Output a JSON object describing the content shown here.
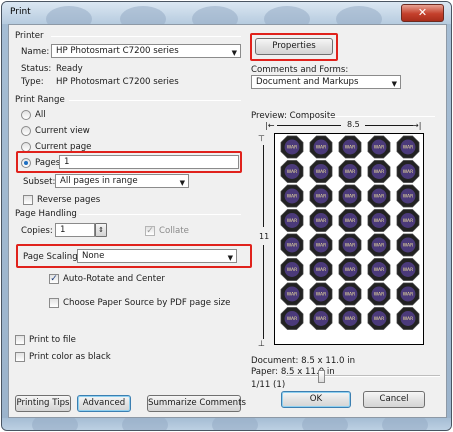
{
  "window": {
    "title": "Print",
    "close_glyph": "✕"
  },
  "printer": {
    "section_label": "Printer",
    "name_label": "Name:",
    "name_value": "HP Photosmart C7200 series",
    "status_label": "Status:",
    "status_value": "Ready",
    "type_label": "Type:",
    "type_value": "HP Photosmart C7200 series",
    "properties_label": "Properties",
    "comments_label": "Comments and Forms:",
    "comments_value": "Document and Markups"
  },
  "print_range": {
    "section_label": "Print Range",
    "all_label": "All",
    "current_view_label": "Current view",
    "current_page_label": "Current page",
    "pages_label": "Pages",
    "pages_value": "1",
    "subset_label": "Subset:",
    "subset_value": "All pages in range",
    "reverse_label": "Reverse pages",
    "selected": "pages"
  },
  "page_handling": {
    "section_label": "Page Handling",
    "copies_label": "Copies:",
    "copies_value": "1",
    "collate_label": "Collate",
    "scaling_label": "Page Scaling:",
    "scaling_value": "None",
    "auto_rotate_label": "Auto-Rotate and Center",
    "choose_source_label": "Choose Paper Source by PDF page size"
  },
  "options": {
    "print_to_file_label": "Print to file",
    "print_color_black_label": "Print color as black"
  },
  "preview": {
    "title": "Preview: Composite",
    "width_label": "8.5",
    "height_label": "11",
    "document_label": "Document: 8.5 x 11.0 in",
    "paper_label": "Paper: 8.5 x 11.0 in",
    "page_indicator": "1/11 (1)",
    "sticker_text": "WAR"
  },
  "footer": {
    "printing_tips": "Printing Tips",
    "advanced": "Advanced",
    "summarize": "Summarize Comments",
    "ok": "OK",
    "cancel": "Cancel"
  }
}
